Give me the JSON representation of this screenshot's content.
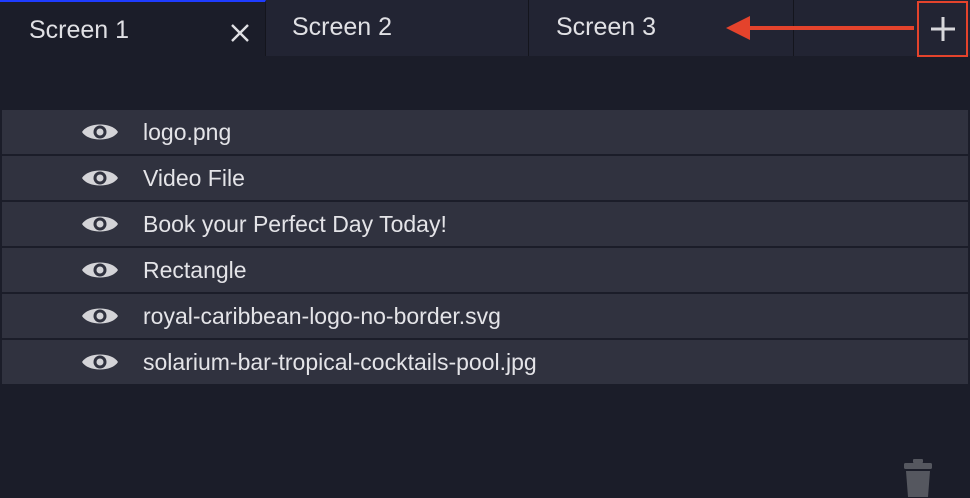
{
  "tabs": [
    {
      "label": "Screen 1",
      "active": true
    },
    {
      "label": "Screen 2",
      "active": false
    },
    {
      "label": "Screen 3",
      "active": false
    }
  ],
  "tab_close_icon": "close-icon",
  "add_tab_icon": "plus-icon",
  "annotation": {
    "icon": "left-arrow-icon",
    "color": "#e4432c"
  },
  "layers": [
    {
      "name": "logo.png",
      "visible": true
    },
    {
      "name": "Video File",
      "visible": true
    },
    {
      "name": "Book your Perfect Day Today!",
      "visible": true
    },
    {
      "name": "Rectangle",
      "visible": true
    },
    {
      "name": "royal-caribbean-logo-no-border.svg",
      "visible": true
    },
    {
      "name": "solarium-bar-tropical-cocktails-pool.jpg",
      "visible": true
    }
  ],
  "delete_icon": "trash-icon",
  "colors": {
    "background": "#1b1d29",
    "tab_bar": "#222433",
    "active_tab_indicator": "#1e3cff",
    "row": "#30323f",
    "highlight": "#e4432c"
  }
}
